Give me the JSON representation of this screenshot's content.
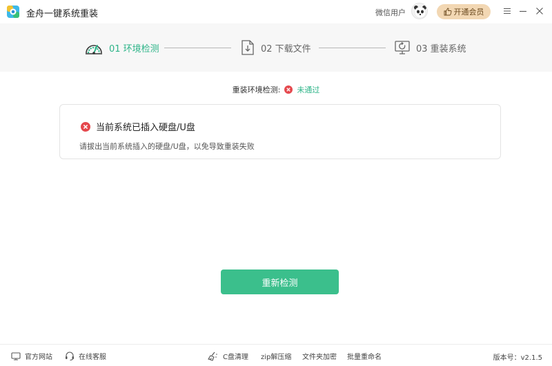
{
  "app": {
    "title": "金舟一键系统重装"
  },
  "header": {
    "user_label": "微信用户",
    "vip_label": "开通会员"
  },
  "steps": [
    {
      "label": "01 环境检测",
      "icon": "gauge-icon",
      "active": true
    },
    {
      "label": "02 下载文件",
      "icon": "download-file-icon",
      "active": false
    },
    {
      "label": "03 重装系统",
      "icon": "reinstall-icon",
      "active": false
    }
  ],
  "status": {
    "label": "重装环境检测:",
    "value": "未通过"
  },
  "result": {
    "title": "当前系统已插入硬盘/U盘",
    "description": "请拔出当前系统插入的硬盘/U盘，以免导致重装失败"
  },
  "actions": {
    "recheck": "重新检测"
  },
  "footer": {
    "website": "官方网站",
    "support": "在线客服",
    "c_clean": "C盘清理",
    "zip": "zip解压缩",
    "folder_encrypt": "文件夹加密",
    "batch_rename": "批量重命名",
    "version": "版本号：v2.1.5"
  },
  "colors": {
    "accent": "#2db488",
    "button": "#3bbf8c",
    "error": "#e5484d",
    "vip": "#f2d7b3"
  }
}
